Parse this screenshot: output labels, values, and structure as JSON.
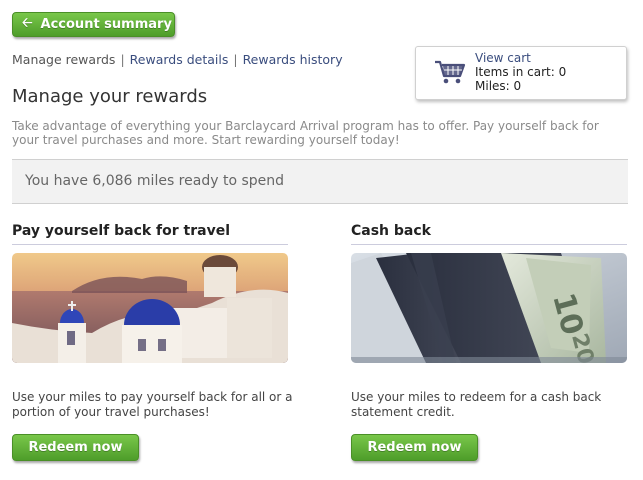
{
  "header": {
    "account_summary_label": "Account summary"
  },
  "subnav": {
    "manage": "Manage rewards",
    "details": "Rewards details",
    "history": "Rewards history",
    "separator": "|"
  },
  "cart": {
    "view_cart": "View cart",
    "items_line": "Items in cart: 0",
    "miles_line": "Miles: 0",
    "icon": "shopping-cart-icon"
  },
  "main": {
    "title": "Manage your rewards",
    "intro": "Take advantage of everything your Barclaycard Arrival program has to offer. Pay yourself back for your travel purchases and more. Start rewarding yourself today!",
    "miles_ready": "You have 6,086 miles ready to spend"
  },
  "cards": [
    {
      "title": "Pay yourself back for travel",
      "image": "santorini-travel-image",
      "description": "Use your miles to pay yourself back for all or a portion of your travel purchases!",
      "button": "Redeem now"
    },
    {
      "title": "Cash back",
      "image": "wallet-cash-image",
      "description": "Use your miles to redeem for a cash back statement credit.",
      "button": "Redeem now"
    }
  ],
  "colors": {
    "button_green": "#5fae35",
    "link_blue": "#3a4d7e",
    "cart_icon": "#4a4f7a"
  }
}
